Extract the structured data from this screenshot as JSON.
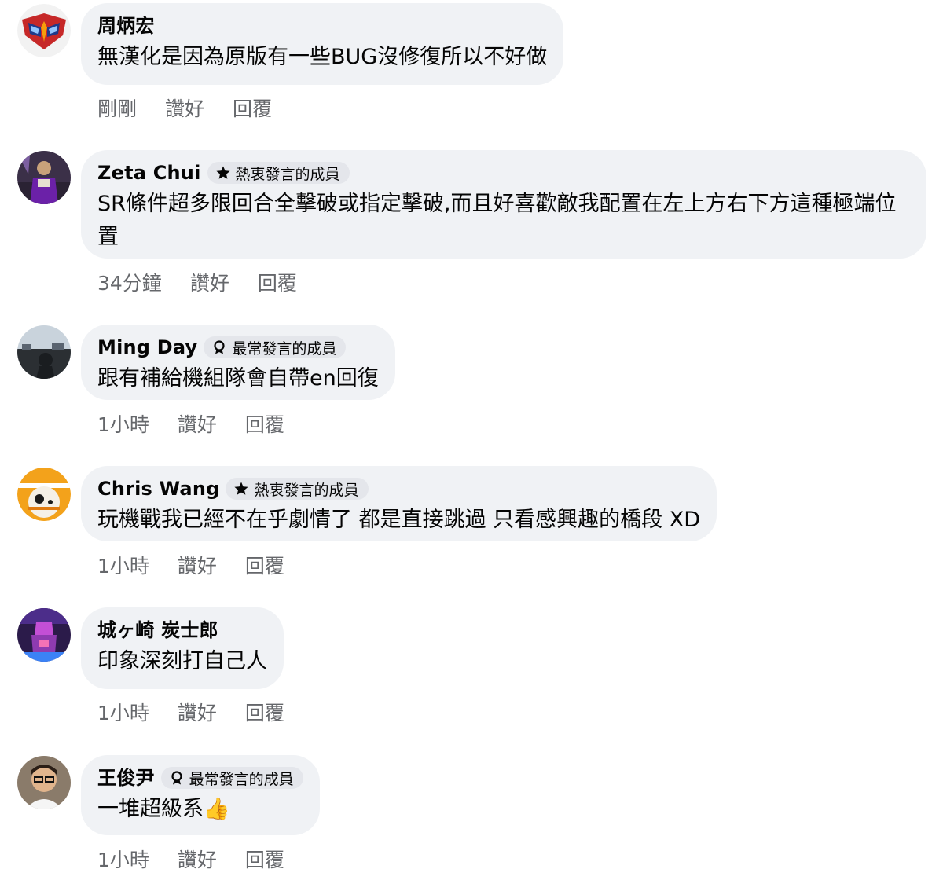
{
  "actions": {
    "like_label": "讚好",
    "reply_label": "回覆"
  },
  "comments": [
    {
      "author": "周炳宏",
      "badge": "",
      "text": "無漢化是因為原版有一些BUG沒修復所以不好做",
      "time": "剛剛"
    },
    {
      "author": "Zeta Chui",
      "badge": "熱衷發言的成員",
      "badge_icon": "star-icon",
      "text": "SR條件超多限回合全擊破或指定擊破,而且好喜歡敵我配置在左上方右下方這種極端位置",
      "time": "34分鐘"
    },
    {
      "author": "Ming Day",
      "badge": "最常發言的成員",
      "badge_icon": "medal-icon",
      "text": "跟有補給機組隊會自帶en回復",
      "time": "1小時"
    },
    {
      "author": "Chris Wang",
      "badge": "熱衷發言的成員",
      "badge_icon": "star-icon",
      "text": "玩機戰我已經不在乎劇情了 都是直接跳過 只看感興趣的橋段 XD",
      "time": "1小時"
    },
    {
      "author": "城ヶ崎 炭士郎",
      "badge": "",
      "text": "印象深刻打自己人",
      "time": "1小時"
    },
    {
      "author": "王俊尹",
      "badge": "最常發言的成員",
      "badge_icon": "medal-icon",
      "text": "一堆超級系👍",
      "time": "1小時"
    }
  ]
}
